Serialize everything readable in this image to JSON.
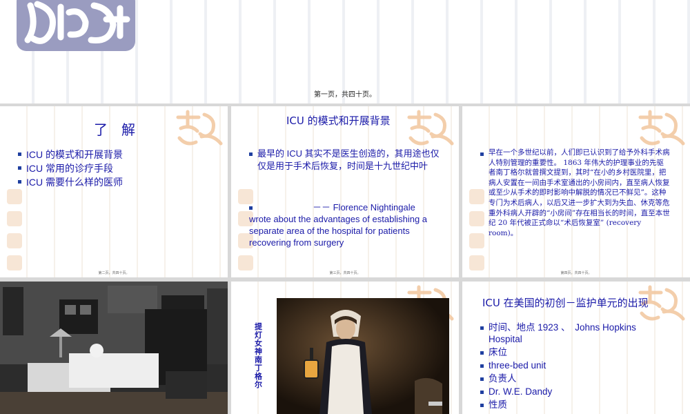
{
  "top": {
    "page_label": "第一页，共四十页。"
  },
  "s2": {
    "title": "了　解",
    "items": [
      "ICU 的模式和开展背景",
      "ICU 常用的诊疗手段",
      "ICU 需要什么样的医师"
    ],
    "footer": "第二页，共四十页。"
  },
  "s3": {
    "title": "ICU 的模式和开展背景",
    "item1": "最早的 ICU 其实不是医生创造的，其用途也仅仅是用于手术后恢复，时间是十九世纪中叶",
    "dash": "－－ Florence Nightingale",
    "quote": "wrote about the advantages of establishing a separate area of the hospital for patients recovering from surgery",
    "footer": "第三页，共四十页。"
  },
  "s4": {
    "text": "早在一个多世纪以前，人们即已认识到了给予外科手术病人特别管理的重要性。 1863 年伟大的护理事业的先驱者南丁格尔就曾撰文提到，其时“在小的乡村医院里，把病人安置在一间由手术室通出的小房间内，直至病人恢复或至少从手术的即时影响中解脱的情况已不鲜见”。这种专门为术后病人，以后又进一步扩大到为失血、休克等危重外科病人开辟的“小房间”存在相当长的时间，直至本世纪 20 年代被正式命以“术后恢复室” (recovery room)。",
    "footer": "第四页，共四十页。"
  },
  "s6": {
    "vertical": "提灯女神南丁格尔"
  },
  "s7": {
    "title": "ICU 在美国的初创－监护单元的出现",
    "items": [
      "时间、地点 1923 、　Johns Hopkins Hospital",
      "床位",
      " three-bed unit",
      "负责人",
      " Dr. W.E. Dandy",
      "性质"
    ]
  },
  "colors": {
    "text_blue": "#1a1aa8",
    "seal_purple": "#9a9cc0",
    "deco_orange": "#f2c9a2"
  }
}
